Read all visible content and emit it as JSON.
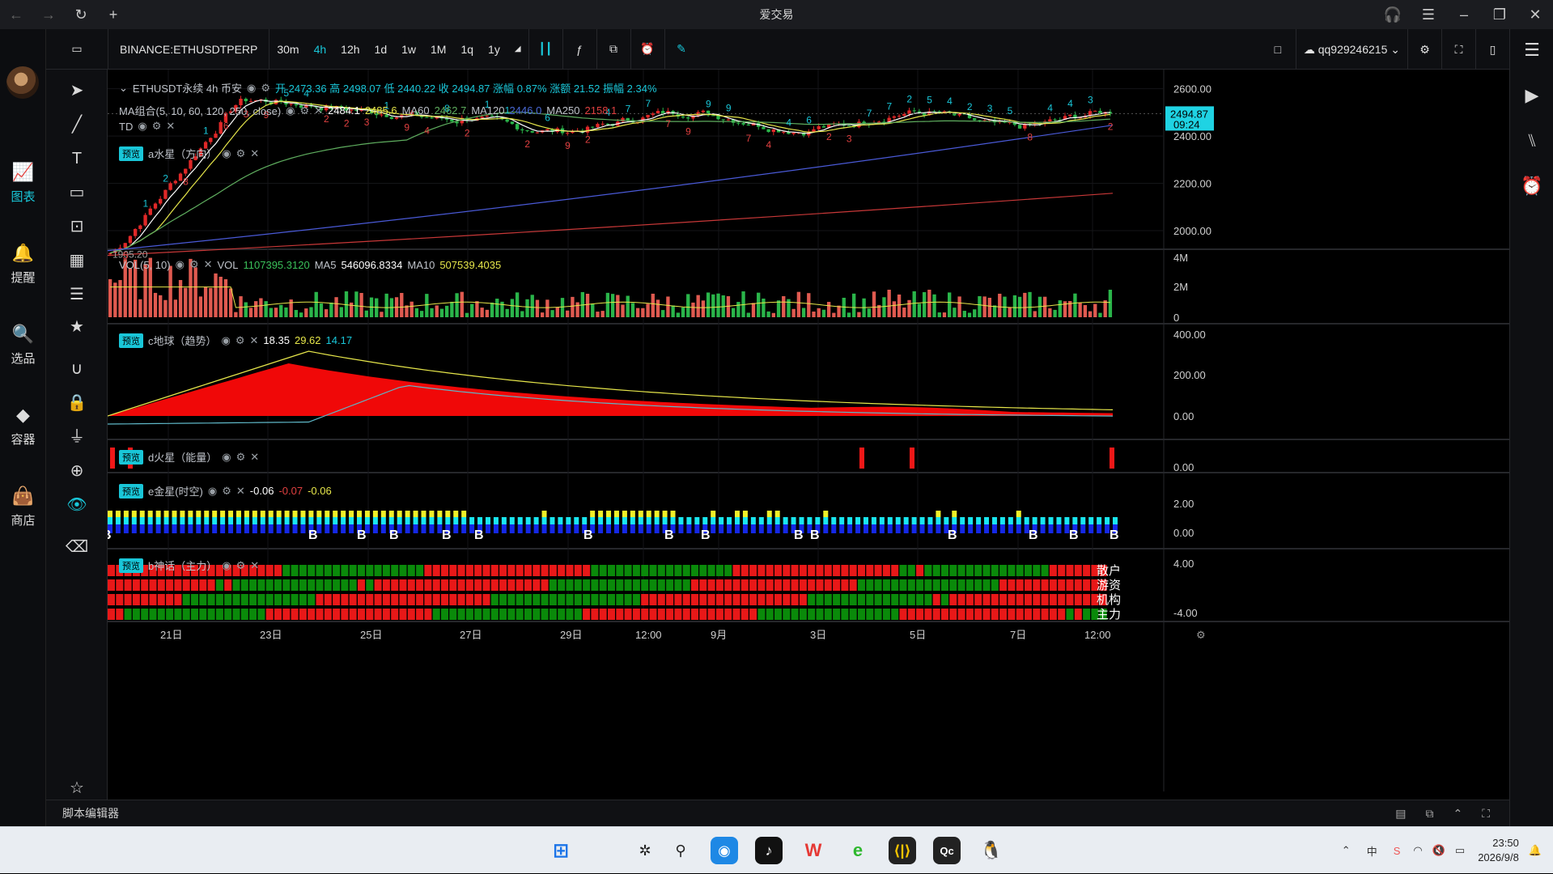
{
  "window": {
    "title": "爱交易"
  },
  "leftnav": {
    "items": [
      {
        "label": "图表",
        "icon": "chart-icon",
        "active": true
      },
      {
        "label": "提醒",
        "icon": "bell-icon",
        "active": false
      },
      {
        "label": "选品",
        "icon": "magnify-chart-icon",
        "active": false
      },
      {
        "label": "容器",
        "icon": "container-icon",
        "active": false
      },
      {
        "label": "商店",
        "icon": "shop-bag-icon",
        "active": false
      }
    ]
  },
  "toolbar": {
    "symbol": "BINANCE:ETHUSDTPERP",
    "intervals": [
      "30m",
      "4h",
      "12h",
      "1d",
      "1w",
      "1M",
      "1q",
      "1y"
    ],
    "active_interval": "4h",
    "account": "qq929246215"
  },
  "legends": {
    "main": {
      "name": "ETHUSDT永续 4h 币安",
      "open_label": "开",
      "open": "2473.36",
      "high_label": "高",
      "high": "2498.07",
      "low_label": "低",
      "low": "2440.22",
      "close_label": "收",
      "close": "2494.87",
      "chg_label": "涨幅",
      "chg": "0.87%",
      "amt_label": "涨额",
      "amt": "21.52",
      "amp_label": "振幅",
      "amp": "2.34%"
    },
    "ma": {
      "label": "MA组合(5, 10, 60, 120, 250, close)",
      "ma5": "2484.1",
      "ma10": "2485.6",
      "ma60_label": "MA60",
      "ma60": "2462.7",
      "ma120_label": "MA120",
      "ma120": "2446.0",
      "ma250_label": "MA250",
      "ma250": "2158.1"
    },
    "td": {
      "label": "TD"
    },
    "a": {
      "tag": "预览",
      "label": "a水星（方向）"
    },
    "vol": {
      "label": "VOL(5, 10)",
      "vol_label": "VOL",
      "vol": "1107395.3120",
      "ma5_label": "MA5",
      "ma5": "546096.8334",
      "ma10_label": "MA10",
      "ma10": "507539.4035"
    },
    "c": {
      "tag": "预览",
      "label": "c地球（趋势）",
      "v1": "18.35",
      "v2": "29.62",
      "v3": "14.17"
    },
    "d": {
      "tag": "预览",
      "label": "d火星（能量）"
    },
    "e": {
      "tag": "预览",
      "label": "e金星(时空)",
      "v1": "-0.06",
      "v2": "-0.07",
      "v3": "-0.06"
    },
    "b": {
      "tag": "预览",
      "label": "b神话（主力）"
    }
  },
  "axis": {
    "price_ticks": [
      "2600.00",
      "2400.00",
      "2200.00",
      "2000.00"
    ],
    "last_price": "2494.87",
    "countdown": "09:24",
    "low_mark": "1905.20",
    "vol_ticks": [
      "4M",
      "2M",
      "0"
    ],
    "c_ticks": [
      "400.00",
      "200.00",
      "0.00"
    ],
    "d_ticks": [
      "0.00"
    ],
    "e_ticks": [
      "2.00",
      "0.00"
    ],
    "b_ticks": [
      "4.00",
      "-4.00"
    ],
    "time_ticks": [
      "21日",
      "23日",
      "25日",
      "27日",
      "29日",
      "12:00",
      "9月",
      "3日",
      "5日",
      "7日",
      "12:00"
    ]
  },
  "b_rows": [
    "散户",
    "游资",
    "机构",
    "主力"
  ],
  "bottombar": {
    "label": "脚本编辑器"
  },
  "taskbar": {
    "time": "23:50",
    "date": "2026/9/8",
    "lang": "中"
  },
  "chart_data": {
    "type": "candlestick",
    "series_close_start": 1905.2,
    "ylim": [
      1880,
      2640
    ],
    "last_close": 2494.87,
    "high": 2498.07,
    "low": 2440.22,
    "open": 2473.36
  }
}
